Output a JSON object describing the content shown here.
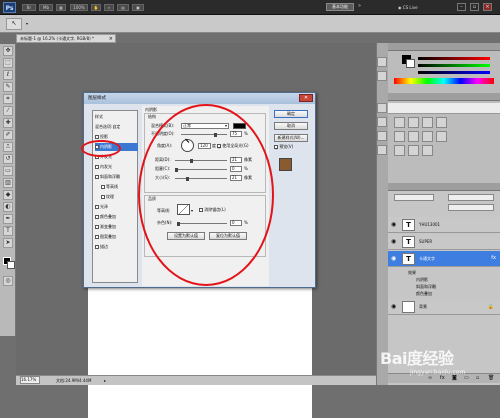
{
  "app": {
    "logo": "Ps",
    "zoom_menu": "100%",
    "workspace_button": "基本功能",
    "cs_live": "CS Live"
  },
  "document": {
    "tab_title": "未标题-1 @ 16.2% (卡通文字, RGB/8) *",
    "status_zoom": "16.17%",
    "status_info": "文档:24.9M/4.44M"
  },
  "dialog": {
    "title": "图层样式",
    "styles": [
      {
        "label": "样式",
        "checkbox": false
      },
      {
        "label": "混合选项:自定",
        "checkbox": false
      },
      {
        "label": "投影",
        "checkbox": true
      },
      {
        "label": "内阴影",
        "checkbox": true,
        "selected": true
      },
      {
        "label": "外发光",
        "checkbox": true
      },
      {
        "label": "内发光",
        "checkbox": true
      },
      {
        "label": "斜面和浮雕",
        "checkbox": true
      },
      {
        "label": "等高线",
        "checkbox": true
      },
      {
        "label": "纹理",
        "checkbox": true
      },
      {
        "label": "光泽",
        "checkbox": true
      },
      {
        "label": "颜色叠加",
        "checkbox": true
      },
      {
        "label": "渐变叠加",
        "checkbox": true
      },
      {
        "label": "图案叠加",
        "checkbox": true
      },
      {
        "label": "描边",
        "checkbox": true
      }
    ],
    "section_title": "内阴影",
    "structure_title": "结构",
    "blend_mode_label": "混合模式(B):",
    "blend_mode_value": "正常",
    "opacity_label": "不透明度(O):",
    "opacity_value": "75",
    "angle_label": "角度(A):",
    "angle_value": "120",
    "degree_unit": "度",
    "global_light_label": "使用全局光(G)",
    "distance_label": "距离(D):",
    "distance_value": "21",
    "choke_label": "阻塞(C):",
    "choke_value": "0",
    "size_label": "大小(S):",
    "size_value": "21",
    "px_unit": "像素",
    "percent_unit": "%",
    "quality_title": "品质",
    "contour_label": "等高线:",
    "antialias_label": "消除锯齿(L)",
    "noise_label": "杂色(N):",
    "noise_value": "0",
    "default_button": "设置为默认值",
    "reset_button": "复位为默认值",
    "ok_button": "确定",
    "cancel_button": "取消",
    "new_style_button": "新建样式(W)...",
    "preview_label": "预览(V)",
    "shadow_color": "#000000"
  },
  "layers": [
    {
      "name": "YHU13001",
      "type": "T"
    },
    {
      "name": "SUPER",
      "type": "T"
    },
    {
      "name": "卡通文字",
      "type": "T",
      "selected": true
    },
    {
      "name": "背景",
      "type": "bg"
    }
  ],
  "layer_effects": {
    "title": "效果",
    "items": [
      "内阴影",
      "斜面和浮雕",
      "颜色叠加"
    ]
  },
  "watermark": {
    "text": "Bai度经验",
    "url": "jingyan.baidu.com"
  },
  "colors": {
    "annotation_red": "#e2141a",
    "selection_blue": "#3a78d1"
  }
}
